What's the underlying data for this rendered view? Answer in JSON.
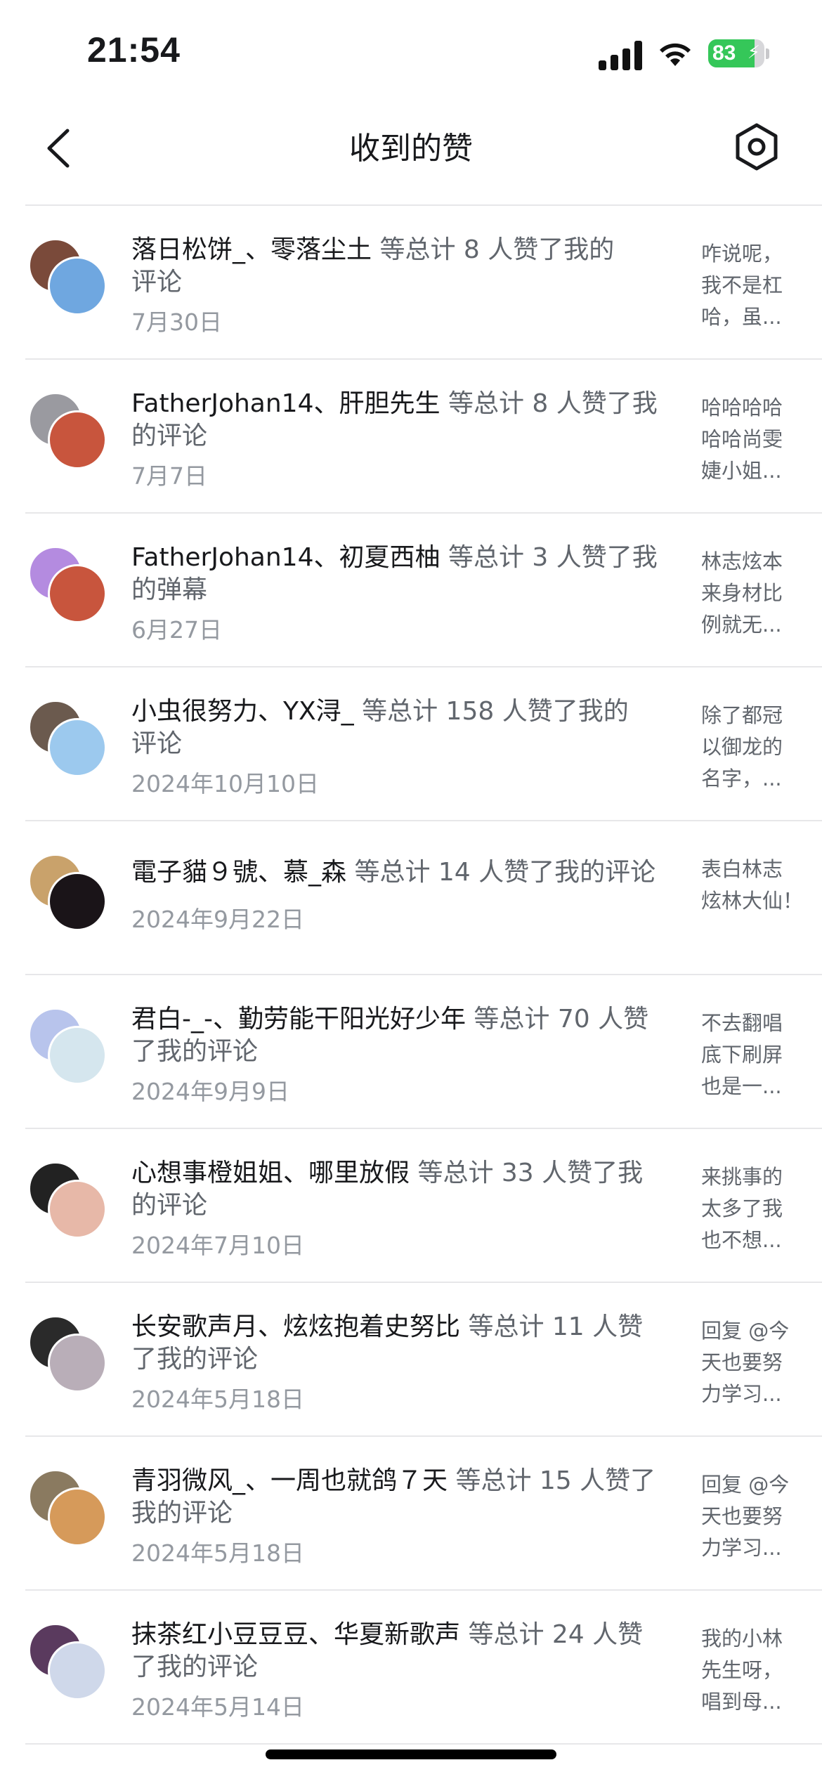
{
  "status_bar": {
    "time": "21:54",
    "battery": "83",
    "battery_level": 0.83
  },
  "header": {
    "title": "收到的赞",
    "back_icon": "chevron-left-icon",
    "settings_icon": "hexagon-settings-icon"
  },
  "items": [
    {
      "names": "落日松饼_、零落尘土",
      "summary_line1": " 等总计 8 人赞了我的",
      "summary_line2": "评论",
      "date": "7月30日",
      "preview": [
        "咋说呢，",
        "我不是杠",
        "哈，虽..."
      ],
      "avatar_colors": [
        "#7a4a3a",
        "#6fa7e0"
      ]
    },
    {
      "names": "FatherJohan14、肝胆先生",
      "summary_line1": " 等总计 8 人赞了我",
      "summary_line2": "的评论",
      "date": "7月7日",
      "preview": [
        "哈哈哈哈",
        "哈哈尚雯",
        "婕小姐..."
      ],
      "avatar_colors": [
        "#9a9aa0",
        "#c8553d"
      ]
    },
    {
      "names": "FatherJohan14、初夏西柚",
      "summary_line1": " 等总计 3 人赞了我",
      "summary_line2": "的弹幕",
      "date": "6月27日",
      "preview": [
        "林志炫本",
        "来身材比",
        "例就无..."
      ],
      "avatar_colors": [
        "#b48be0",
        "#c8553d"
      ]
    },
    {
      "names": "小虫很努力、YX浔_",
      "summary_line1": " 等总计 158 人赞了我的",
      "summary_line2": "评论",
      "date": "2024年10月10日",
      "preview": [
        "除了都冠",
        "以御龙的",
        "名字，..."
      ],
      "avatar_colors": [
        "#6b5a4e",
        "#9cc9ee"
      ]
    },
    {
      "names": "電子貓９號、慕_森",
      "summary_line1": " 等总计 14 人赞了我的评论",
      "summary_line2": "",
      "date": "2024年9月22日",
      "preview": [
        "表白林志",
        "炫林大仙！"
      ],
      "avatar_colors": [
        "#c9a26b",
        "#1a1418"
      ]
    },
    {
      "names": "君白-_-、勤劳能干阳光好少年",
      "summary_line1": " 等总计 70 人赞",
      "summary_line2": "了我的评论",
      "date": "2024年9月9日",
      "preview": [
        "不去翻唱",
        "底下刷屏",
        "也是一..."
      ],
      "avatar_colors": [
        "#b8c4ec",
        "#d5e6ee"
      ]
    },
    {
      "names": "心想事橙姐姐、哪里放假",
      "summary_line1": " 等总计 33 人赞了我",
      "summary_line2": "的评论",
      "date": "2024年7月10日",
      "preview": [
        "来挑事的",
        "太多了我",
        "也不想..."
      ],
      "avatar_colors": [
        "#222222",
        "#e7b8a8"
      ]
    },
    {
      "names": "长安歌声月、炫炫抱着史努比",
      "summary_line1": " 等总计 11 人赞",
      "summary_line2": "了我的评论",
      "date": "2024年5月18日",
      "preview": [
        "回复 @今",
        "天也要努",
        "力学习..."
      ],
      "avatar_colors": [
        "#2a2a2a",
        "#b9aeb8"
      ]
    },
    {
      "names": "青羽微风_、一周也就鸽７天",
      "summary_line1": " 等总计 15 人赞了",
      "summary_line2": "我的评论",
      "date": "2024年5月18日",
      "preview": [
        "回复 @今",
        "天也要努",
        "力学习..."
      ],
      "avatar_colors": [
        "#8a7a60",
        "#d69a5a"
      ]
    },
    {
      "names": "抹茶红小豆豆豆、华夏新歌声",
      "summary_line1": " 等总计 24 人赞",
      "summary_line2": "了我的评论",
      "date": "2024年5月14日",
      "preview": [
        "我的小林",
        "先生呀，",
        "唱到母..."
      ],
      "avatar_colors": [
        "#5a3a5e",
        "#cfd8ea"
      ]
    }
  ]
}
